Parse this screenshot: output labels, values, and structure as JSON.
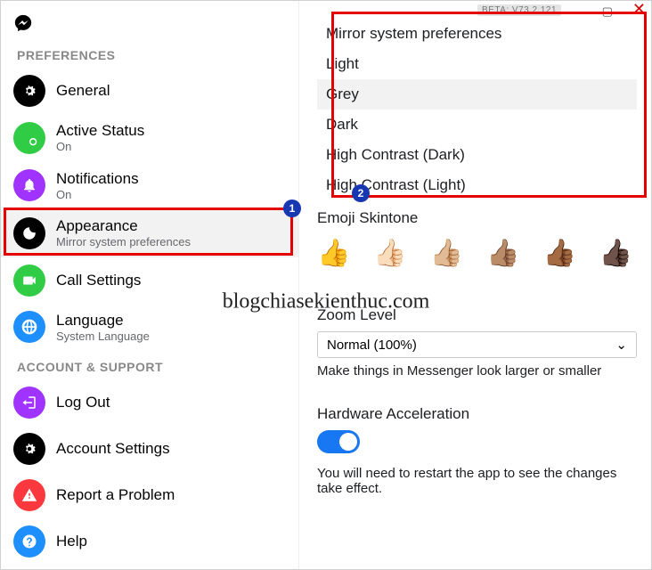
{
  "beta_tag": "BETA: V73.2.121",
  "sidebar": {
    "section_prefs": "PREFERENCES",
    "section_account": "ACCOUNT & SUPPORT",
    "items": {
      "general": {
        "title": "General"
      },
      "active_status": {
        "title": "Active Status",
        "sub": "On"
      },
      "notifications": {
        "title": "Notifications",
        "sub": "On"
      },
      "appearance": {
        "title": "Appearance",
        "sub": "Mirror system preferences"
      },
      "call_settings": {
        "title": "Call Settings"
      },
      "language": {
        "title": "Language",
        "sub": "System Language"
      },
      "log_out": {
        "title": "Log Out"
      },
      "account_settings": {
        "title": "Account Settings"
      },
      "report": {
        "title": "Report a Problem"
      },
      "help": {
        "title": "Help"
      }
    }
  },
  "theme_options": {
    "mirror": "Mirror system preferences",
    "light": "Light",
    "grey": "Grey",
    "dark": "Dark",
    "hc_dark": "High Contrast (Dark)",
    "hc_light": "High Contrast (Light)"
  },
  "emoji_section": {
    "heading": "Emoji Skintone"
  },
  "zoom": {
    "heading": "Zoom Level",
    "value": "Normal (100%)",
    "note": "Make things in Messenger look larger or smaller"
  },
  "hw_accel": {
    "heading": "Hardware Acceleration",
    "note": "You will need to restart the app to see the changes take effect."
  },
  "watermark": "blogchiasekienthuc.com",
  "annotations": {
    "badge1": "1",
    "badge2": "2"
  }
}
